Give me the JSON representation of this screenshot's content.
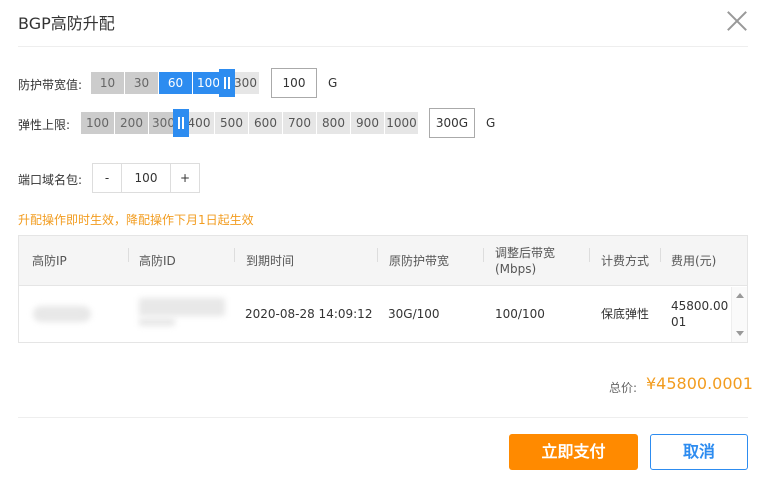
{
  "dialog": {
    "title": "BGP高防升配"
  },
  "protect_bandwidth": {
    "label": "防护带宽值:",
    "options": [
      "10",
      "30",
      "60",
      "100",
      "300"
    ],
    "value": "100",
    "unit": "G"
  },
  "elastic_limit": {
    "label": "弹性上限:",
    "options": [
      "100",
      "200",
      "300",
      "400",
      "500",
      "600",
      "700",
      "800",
      "900",
      "1000"
    ],
    "value": "300G",
    "unit": "G"
  },
  "port_domain": {
    "label": "端口域名包:",
    "minus": "-",
    "value": "100",
    "plus": "+"
  },
  "notice": "升配操作即时生效，降配操作下月1日起生效",
  "table": {
    "headers": [
      "高防IP",
      "高防ID",
      "到期时间",
      "原防护带宽",
      "调整后带宽\n(Mbps)",
      "计费方式",
      "费用(元)"
    ],
    "row": {
      "ip": "",
      "id": "",
      "expire": "2020-08-28 14:09:12",
      "orig_bandwidth": "30G/100",
      "new_bandwidth": "100/100",
      "billing": "保底弹性",
      "fee": "45800.00\n01"
    }
  },
  "total": {
    "label": "总价:",
    "value": "¥45800.0001"
  },
  "buttons": {
    "pay": "立即支付",
    "cancel": "取消"
  },
  "colors": {
    "primary": "#2d8cf0",
    "accent": "#ff8a00",
    "notice": "#f29c1f"
  }
}
